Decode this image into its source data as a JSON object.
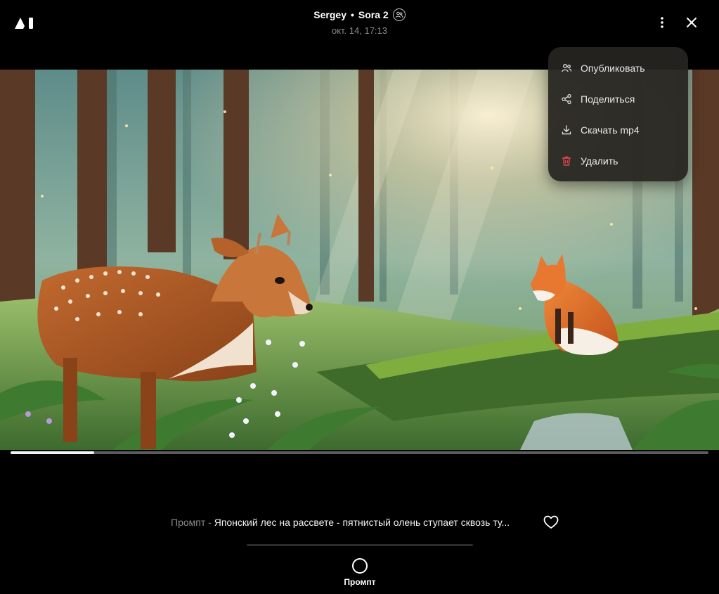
{
  "header": {
    "author": "Sergey",
    "separator": "•",
    "model": "Sora 2",
    "date": "окт. 14, 17:13"
  },
  "icons": {
    "logo": "ai-logo-icon",
    "visibility": "people-icon",
    "more": "more-vertical-icon",
    "close": "close-icon",
    "publish": "people-icon",
    "share": "share-icon",
    "download": "download-icon",
    "delete": "trash-icon",
    "like": "heart-icon",
    "prompt_tab": "circle-icon"
  },
  "menu": {
    "items": [
      {
        "label": "Опубликовать"
      },
      {
        "label": "Поделиться"
      },
      {
        "label": "Скачать mp4"
      },
      {
        "label": "Удалить"
      }
    ]
  },
  "player": {
    "progress": 0.12
  },
  "prompt": {
    "label": "Промпт -",
    "text": "Японский лес на рассвете - пятнистый олень ступает сквозь ту..."
  },
  "bottom_tab": {
    "label": "Промпт"
  },
  "colors": {
    "background": "#000000",
    "menu_bg": "#262420",
    "danger": "#e04848",
    "muted": "#8c8c8c"
  }
}
